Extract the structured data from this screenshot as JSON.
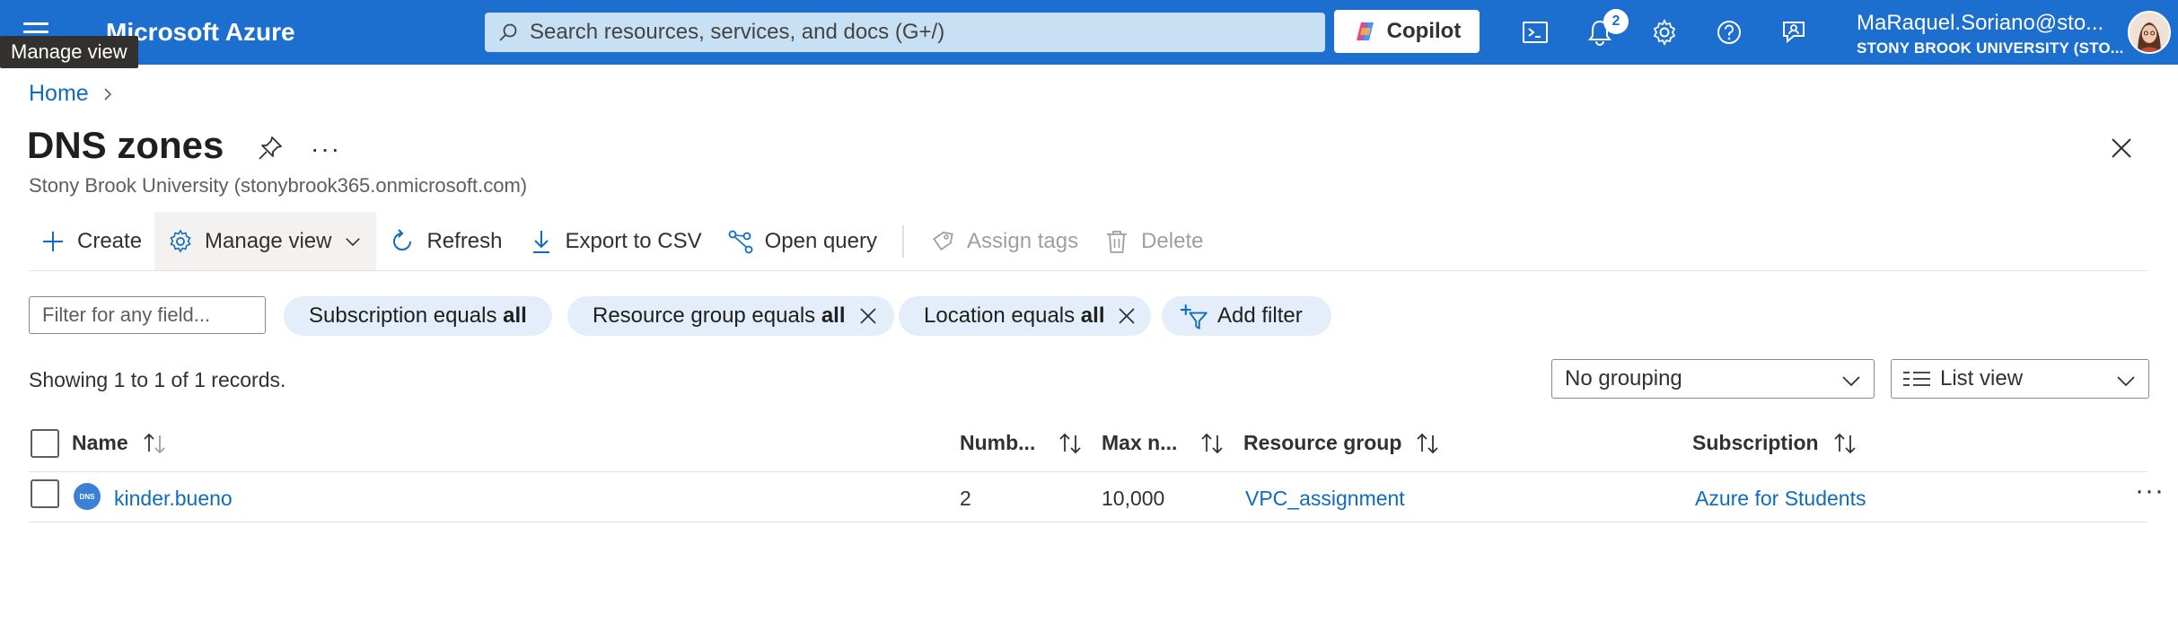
{
  "topbar": {
    "brand": "Microsoft Azure",
    "tooltip": "Manage view",
    "search_placeholder": "Search resources, services, and docs (G+/)",
    "copilot_label": "Copilot",
    "notification_count": "2",
    "account_email": "MaRaquel.Soriano@sto...",
    "account_org": "STONY BROOK UNIVERSITY (STO..."
  },
  "breadcrumb": {
    "home": "Home"
  },
  "header": {
    "title": "DNS zones",
    "more": "···",
    "subtitle": "Stony Brook University (stonybrook365.onmicrosoft.com)"
  },
  "commands": {
    "create": "Create",
    "manage_view": "Manage view",
    "refresh": "Refresh",
    "export_csv": "Export to CSV",
    "open_query": "Open query",
    "assign_tags": "Assign tags",
    "delete": "Delete"
  },
  "filters": {
    "placeholder": "Filter for any field...",
    "subscription": {
      "label": "Subscription equals ",
      "value": "all"
    },
    "resource_group": {
      "label": "Resource group equals ",
      "value": "all"
    },
    "location": {
      "label": "Location equals ",
      "value": "all"
    },
    "add_filter": "Add filter"
  },
  "records_text": "Showing 1 to 1 of 1 records.",
  "grouping": {
    "selected": "No grouping"
  },
  "view_mode": {
    "selected": "List view"
  },
  "table": {
    "columns": {
      "name": "Name",
      "number": "Numb...",
      "max": "Max n...",
      "resource_group": "Resource group",
      "subscription": "Subscription"
    },
    "rows": [
      {
        "icon_text": "DNS",
        "name": "kinder.bueno",
        "number": "2",
        "max": "10,000",
        "resource_group": "VPC_assignment",
        "subscription": "Azure for Students",
        "more": "···"
      }
    ]
  },
  "colors": {
    "topbar": "#1d6fcf",
    "link": "#0f6cbd",
    "pill": "#e3eefa"
  }
}
